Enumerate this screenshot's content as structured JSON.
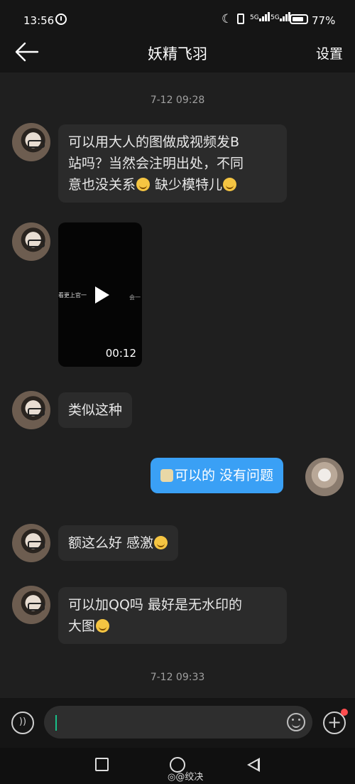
{
  "status_bar": {
    "time": "13:56",
    "signal_1": "5G",
    "signal_2": "5G",
    "battery": "77%"
  },
  "header": {
    "title": "妖精飞羽",
    "settings_label": "设置"
  },
  "timestamps": [
    "7-12 09:28",
    "7-12 09:33"
  ],
  "messages": [
    {
      "from": "other",
      "line1": "可以用大人的图做成视频发B",
      "line2": "站吗？当然会注明出处，不同",
      "line3": "意也没关系",
      "line3b": " 缺少模特儿"
    },
    {
      "from": "other",
      "type": "video",
      "caption": "看更上官一",
      "caption_right": "会一",
      "duration": "00:12"
    },
    {
      "from": "other",
      "text": "类似这种"
    },
    {
      "from": "me",
      "text": "可以的 没有问题"
    },
    {
      "from": "other",
      "text": "额这么好 感激"
    },
    {
      "from": "other",
      "line1": "可以加QQ吗  最好是无水印的",
      "line2": "大图"
    }
  ],
  "input": {
    "placeholder": ""
  },
  "watermark": "◎@绞决",
  "icons": [
    "back-arrow-icon",
    "voice-icon",
    "emoji-icon",
    "plus-icon",
    "play-icon"
  ]
}
